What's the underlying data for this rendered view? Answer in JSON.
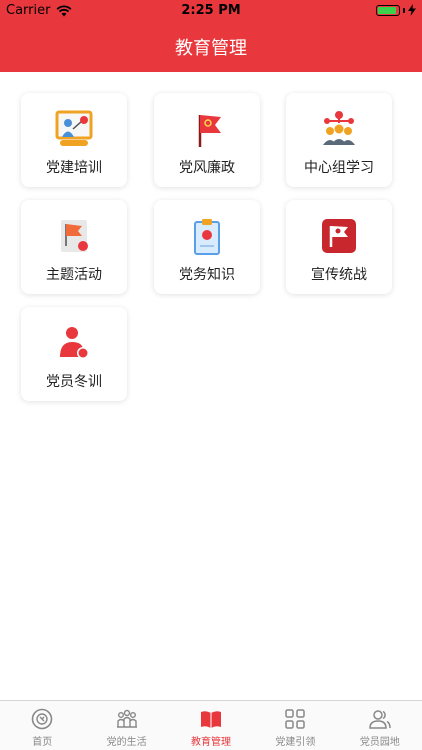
{
  "status_bar": {
    "carrier": "Carrier",
    "time": "2:25 PM"
  },
  "nav": {
    "title": "教育管理"
  },
  "grid": {
    "items": [
      {
        "label": "党建培训",
        "icon": "training-board-icon"
      },
      {
        "label": "党风廉政",
        "icon": "party-flag-icon"
      },
      {
        "label": "中心组学习",
        "icon": "group-study-icon"
      },
      {
        "label": "主题活动",
        "icon": "activity-flag-icon"
      },
      {
        "label": "党务知识",
        "icon": "clipboard-icon"
      },
      {
        "label": "宣传统战",
        "icon": "red-flag-badge-icon"
      },
      {
        "label": "党员冬训",
        "icon": "member-person-icon"
      }
    ]
  },
  "tab_bar": {
    "tabs": [
      {
        "label": "首页",
        "icon": "home-emblem-icon",
        "active": false
      },
      {
        "label": "党的生活",
        "icon": "people-group-icon",
        "active": false
      },
      {
        "label": "教育管理",
        "icon": "book-icon",
        "active": true
      },
      {
        "label": "党建引领",
        "icon": "grid-squares-icon",
        "active": false
      },
      {
        "label": "党员园地",
        "icon": "users-icon",
        "active": false
      }
    ]
  },
  "colors": {
    "brand_red": "#e8383d",
    "inactive_tab": "#888888"
  }
}
